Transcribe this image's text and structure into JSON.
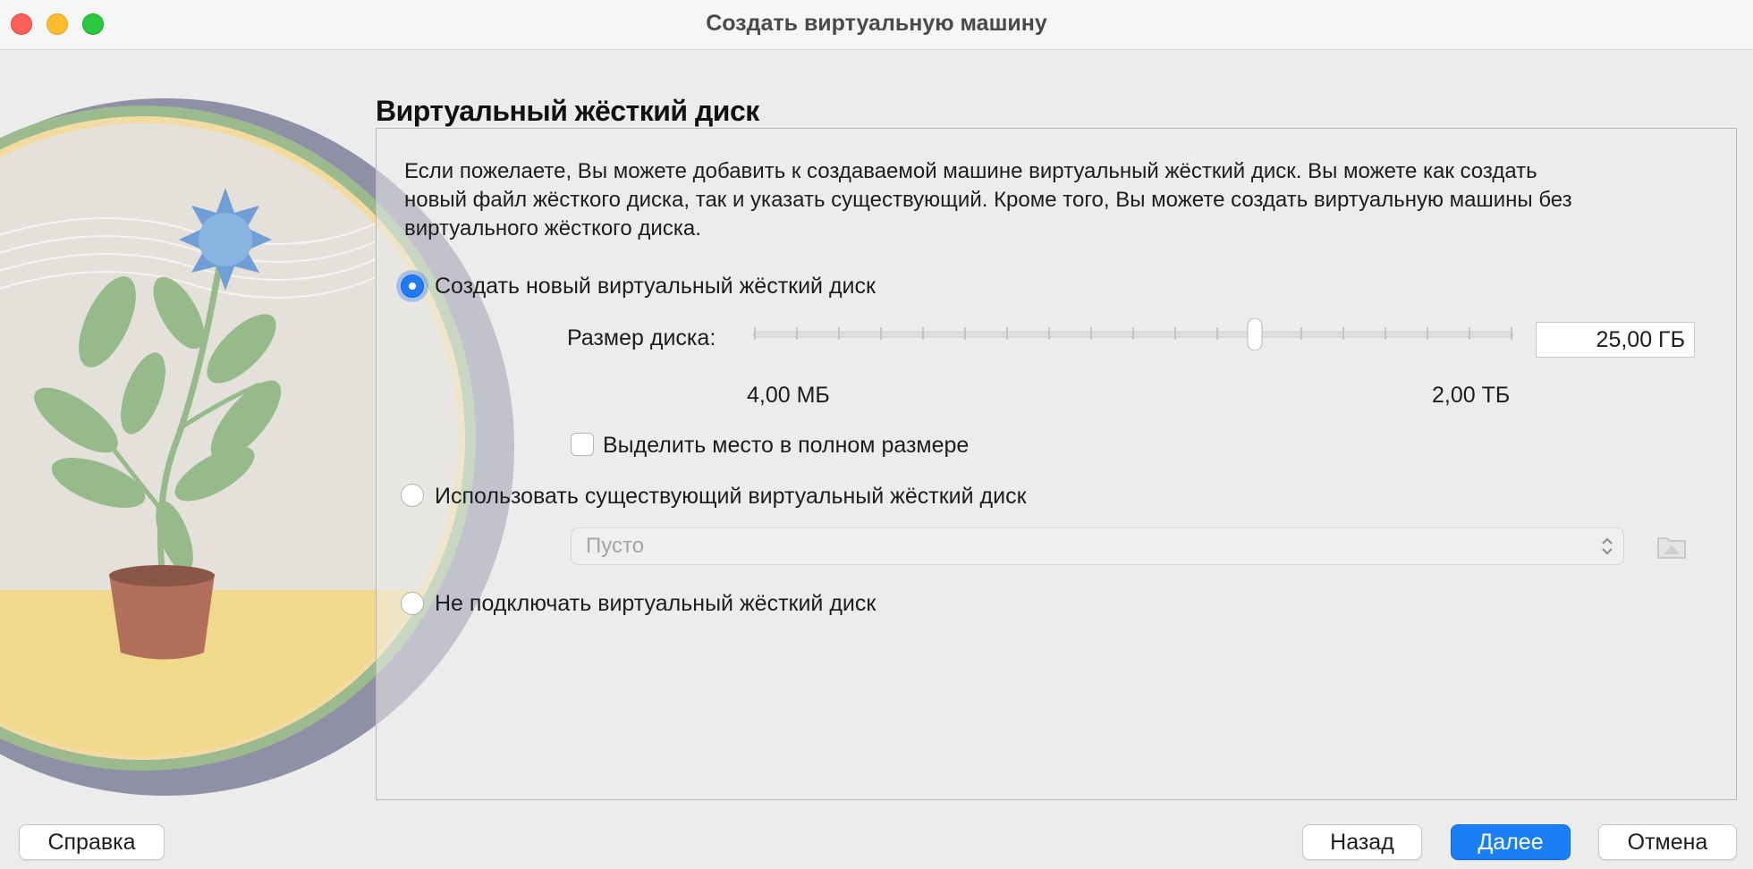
{
  "window": {
    "title": "Создать виртуальную машину"
  },
  "page": {
    "heading": "Виртуальный жёсткий диск",
    "description": "Если пожелаете, Вы можете добавить к создаваемой машине виртуальный жёсткий диск. Вы можете как создать новый файл жёсткого диска, так и указать существующий. Кроме того, Вы можете создать виртуальную машины без виртуального жёсткого диска."
  },
  "options": {
    "create_new": {
      "label": "Создать новый виртуальный жёсткий диск",
      "selected": true
    },
    "use_existing": {
      "label": "Использовать существующий виртуальный жёсткий диск",
      "selected": false
    },
    "no_disk": {
      "label": "Не подключать виртуальный жёсткий диск",
      "selected": false
    }
  },
  "disk_size": {
    "label": "Размер диска:",
    "value": "25,00 ГБ",
    "min_label": "4,00 МБ",
    "max_label": "2,00 ТБ",
    "slider_fraction": 0.66,
    "tick_count": 19
  },
  "preallocate": {
    "label": "Выделить место в полном размере",
    "checked": false
  },
  "existing_disk_select": {
    "value": "Пусто"
  },
  "buttons": {
    "help": "Справка",
    "back": "Назад",
    "next": "Далее",
    "cancel": "Отмена"
  },
  "colors": {
    "accent": "#1a7ff6",
    "close": "#fe5f57",
    "minimize": "#febc2e",
    "maximize": "#28c840"
  }
}
